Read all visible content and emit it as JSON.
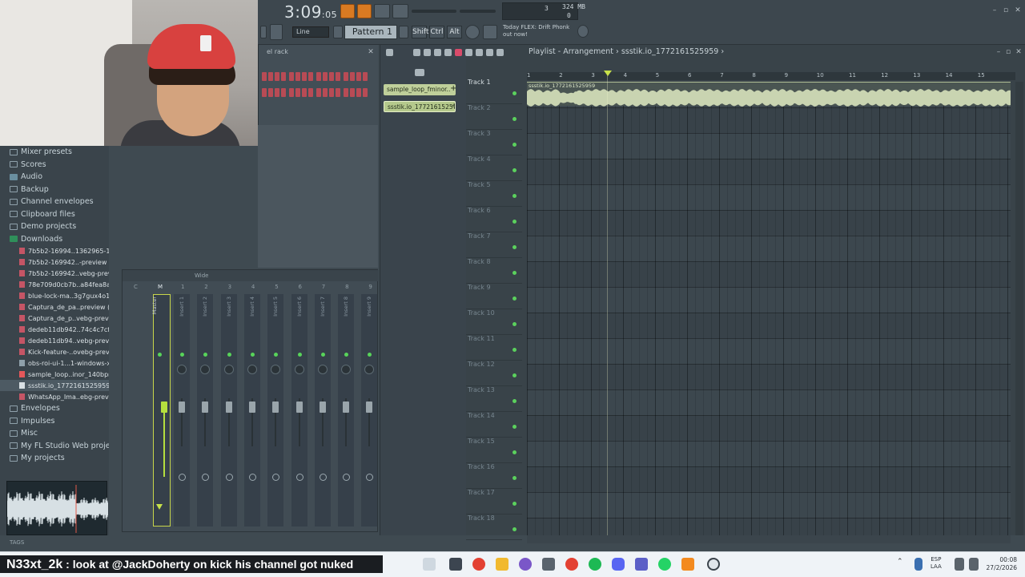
{
  "toolbar": {
    "time_main": "3:09",
    "time_sub": "05",
    "mode_line": "Line",
    "pattern": "Pattern 1",
    "keys": [
      "Shift",
      "Ctrl",
      "Alt"
    ],
    "hint_line1": "Today  FLEX: Drift Phonk",
    "hint_line2": "out now!",
    "cpu_value": "3",
    "cpu_zero": "0",
    "memory": "324 MB"
  },
  "channel_rack": {
    "title": "el rack"
  },
  "browser": {
    "items_top": [
      {
        "label": "Mixer presets",
        "kind": "folder"
      },
      {
        "label": "Scores",
        "kind": "folder"
      },
      {
        "label": "Audio",
        "kind": "special"
      },
      {
        "label": "Backup",
        "kind": "folder"
      },
      {
        "label": "Channel envelopes",
        "kind": "folder"
      },
      {
        "label": "Clipboard files",
        "kind": "folder"
      },
      {
        "label": "Demo projects",
        "kind": "folder"
      },
      {
        "label": "Downloads",
        "kind": "open"
      }
    ],
    "files": [
      {
        "label": "7b5b2-16994..1362965-1920",
        "kind": "img"
      },
      {
        "label": "7b5b2-169942..-preview (1)",
        "kind": "img"
      },
      {
        "label": "7b5b2-169942..vebg-preview",
        "kind": "img"
      },
      {
        "label": "78e709d0cb7b..a84fea8aa1f",
        "kind": "img"
      },
      {
        "label": "blue-lock-ma..3g7gux4o1zils",
        "kind": "img"
      },
      {
        "label": "Captura_de_pa..preview (1)",
        "kind": "img"
      },
      {
        "label": "Captura_de_p..vebg-preview",
        "kind": "img"
      },
      {
        "label": "dedeb11db942..74c4c7cf087",
        "kind": "img"
      },
      {
        "label": "dedeb11db94..vebg-preview",
        "kind": "img"
      },
      {
        "label": "Kick-feature-..ovebg-preview",
        "kind": "img"
      },
      {
        "label": "obs-roi-ui-1...1-windows-x64",
        "kind": "exe"
      },
      {
        "label": "sample_loop..inor_140bpm",
        "kind": "audio"
      },
      {
        "label": "ssstik.io_1772161525959",
        "kind": "sel"
      },
      {
        "label": "WhatsApp_Ima..ebg-preview",
        "kind": "img"
      }
    ],
    "items_bottom": [
      {
        "label": "Envelopes",
        "kind": "folder"
      },
      {
        "label": "Impulses",
        "kind": "folder"
      },
      {
        "label": "Misc",
        "kind": "folder"
      },
      {
        "label": "My FL Studio Web projects",
        "kind": "folder"
      },
      {
        "label": "My projects",
        "kind": "folder"
      }
    ],
    "tags_label": "TAGS"
  },
  "mixer": {
    "header_label": "Wide",
    "master_label": "Master",
    "insert_numbers": [
      "1",
      "2",
      "3",
      "4",
      "5",
      "6",
      "7",
      "8",
      "9"
    ],
    "insert_labels": [
      "Insert 1",
      "Insert 2",
      "Insert 3",
      "Insert 4",
      "Insert 5",
      "Insert 6",
      "Insert 7",
      "Insert 8",
      "Insert 9"
    ],
    "col_c": "C",
    "col_m": "M"
  },
  "picker": {
    "clips": [
      "sample_loop_fminor..",
      "ssstik.io_17721615257..."
    ]
  },
  "playlist": {
    "title": "Playlist - Arrangement",
    "separator": "›",
    "project": "ssstik.io_1772161525959",
    "ruler": [
      "1",
      "2",
      "3",
      "4",
      "5",
      "6",
      "7",
      "8",
      "9",
      "10",
      "11",
      "12",
      "13",
      "14",
      "15"
    ],
    "audio_clip_label": "ssstik.io_1772161525959",
    "tracks": [
      "Track 1",
      "Track 2",
      "Track 3",
      "Track 4",
      "Track 5",
      "Track 6",
      "Track 7",
      "Track 8",
      "Track 9",
      "Track 10",
      "Track 11",
      "Track 12",
      "Track 13",
      "Track 14",
      "Track 15",
      "Track 16",
      "Track 17",
      "Track 18"
    ]
  },
  "overlay": {
    "chat_user": "N33xt_2k",
    "chat_message": " : look at @JackDoherty on kick his channel got nuked"
  },
  "taskbar": {
    "lang_top": "ESP",
    "lang_bottom": "LAA",
    "time": "00:08",
    "date": "27/2/2026"
  },
  "colors": {
    "accent_orange": "#d97a22",
    "clip_green": "#bfcf9a",
    "led_green": "#5bd15d",
    "step_red": "#b84b55"
  }
}
